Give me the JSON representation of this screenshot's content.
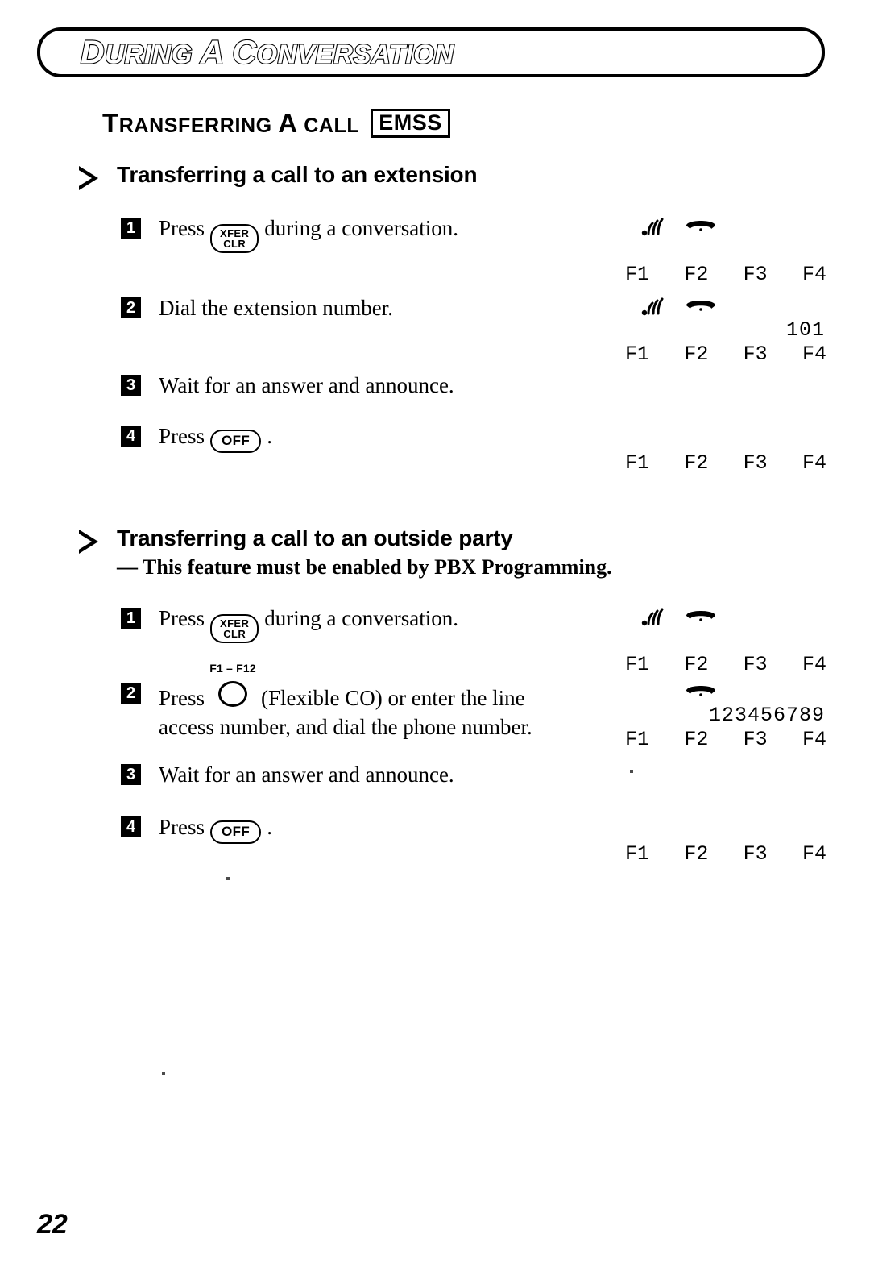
{
  "banner": {
    "title": "During a Conversation",
    "title_words": [
      "During",
      "a",
      "Conversation"
    ]
  },
  "section": {
    "title": "Transferring a call",
    "badge": "EMSS"
  },
  "subsections": [
    {
      "heading": "Transferring a call to an extension",
      "note": "",
      "steps": [
        {
          "number": "1",
          "text_before": "Press",
          "key": "XFER\nCLR",
          "key_line1": "XFER",
          "key_line2": "CLR",
          "text_after": "during a conversation."
        },
        {
          "number": "2",
          "text": "Dial the extension number."
        },
        {
          "number": "3",
          "text": "Wait for an answer and announce."
        },
        {
          "number": "4",
          "text_before": "Press",
          "key": "OFF",
          "text_after": "."
        }
      ]
    },
    {
      "heading": "Transferring a call to an outside party",
      "note": "— This feature must be enabled by PBX Programming.",
      "steps": [
        {
          "number": "1",
          "text_before": "Press",
          "key": "XFER\nCLR",
          "key_line1": "XFER",
          "key_line2": "CLR",
          "text_after": "during a conversation."
        },
        {
          "number": "2",
          "text_before": "Press",
          "key_label": "F1 – F12",
          "key": "flexible-co-circle",
          "text_after": "(Flexible CO) or enter the line",
          "text_line2": "access number, and dial the phone number."
        },
        {
          "number": "3",
          "text": "Wait for an answer and announce."
        },
        {
          "number": "4",
          "text_before": "Press",
          "key": "OFF",
          "text_after": "."
        }
      ]
    }
  ],
  "displays": [
    {
      "id": "display-1",
      "antenna": true,
      "handset": true,
      "value": "",
      "fkeys": [
        "F1",
        "F2",
        "F3",
        "F4"
      ]
    },
    {
      "id": "display-2",
      "antenna": true,
      "handset": true,
      "value": "101",
      "fkeys": [
        "F1",
        "F2",
        "F3",
        "F4"
      ]
    },
    {
      "id": "display-3",
      "antenna": false,
      "handset": false,
      "value": "",
      "fkeys": [
        "F1",
        "F2",
        "F3",
        "F4"
      ]
    },
    {
      "id": "display-4",
      "antenna": true,
      "handset": true,
      "value": "",
      "fkeys": [
        "F1",
        "F2",
        "F3",
        "F4"
      ]
    },
    {
      "id": "display-5",
      "antenna": false,
      "handset": true,
      "value": "123456789",
      "fkeys": [
        "F1",
        "F2",
        "F3",
        "F4"
      ]
    },
    {
      "id": "display-6",
      "antenna": false,
      "handset": false,
      "value": "",
      "fkeys": [
        "F1",
        "F2",
        "F3",
        "F4"
      ]
    }
  ],
  "footer": {
    "page_number": "22"
  },
  "colors": {
    "ink": "#000000",
    "paper": "#ffffff"
  }
}
